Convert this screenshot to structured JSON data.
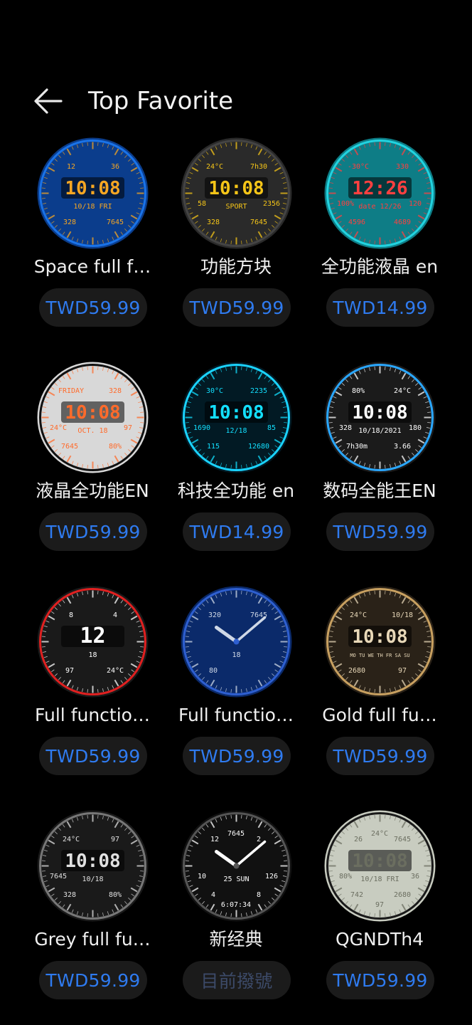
{
  "header": {
    "title": "Top Favorite",
    "back_icon": "back-arrow-icon"
  },
  "items": [
    {
      "name": "Space full f…",
      "price": "TWD59.99"
    },
    {
      "name": "功能方块",
      "price": "TWD59.99"
    },
    {
      "name": "全功能液晶 en",
      "price": "TWD14.99"
    },
    {
      "name": "液晶全功能EN",
      "price": "TWD59.99"
    },
    {
      "name": "科技全功能 en",
      "price": "TWD14.99"
    },
    {
      "name": "数码全能王EN",
      "price": "TWD59.99"
    },
    {
      "name": "Full functio…",
      "price": "TWD59.99"
    },
    {
      "name": "Full functio…",
      "price": "TWD59.99"
    },
    {
      "name": "Gold full fu…",
      "price": "TWD59.99"
    },
    {
      "name": "Grey full fu…",
      "price": "TWD59.99"
    },
    {
      "name": "新经典",
      "price": "目前撥號"
    },
    {
      "name": "QGNDTh4",
      "price": "TWD59.99"
    }
  ],
  "faces": [
    {
      "time": "10:08",
      "date": "10/18  FRI",
      "extra": [
        "12",
        "36",
        "328",
        "7645"
      ],
      "colors": [
        "#0b3d8c",
        "#1a73e8",
        "#f5a623"
      ]
    },
    {
      "time": "10:08",
      "date": "SPORT",
      "extra": [
        "24°C",
        "7h30",
        "328",
        "7645",
        "58",
        "2356"
      ],
      "colors": [
        "#2a2a2a",
        "#444",
        "#f5c518"
      ]
    },
    {
      "time": "12:26",
      "date": "date 12/26",
      "extra": [
        "-30°C",
        "330",
        "4596",
        "4689",
        "100%",
        "120"
      ],
      "colors": [
        "#0e7d86",
        "#22d3e0",
        "#ff4040"
      ]
    },
    {
      "time": "10:08",
      "date": "OCT. 18",
      "extra": [
        "FRIDAY",
        "328",
        "7645",
        "80%",
        "24°C",
        "97"
      ],
      "colors": [
        "#d8d8d8",
        "#111",
        "#ff6b2b"
      ]
    },
    {
      "time": "10:08",
      "date": "12/18",
      "extra": [
        "30°C",
        "2235",
        "115",
        "12680",
        "1690",
        "85"
      ],
      "colors": [
        "#021a24",
        "#1ad3ff",
        "#13e0ff"
      ]
    },
    {
      "time": "10:08",
      "date": "10/18/2021",
      "extra": [
        "80%",
        "24°C",
        "7h30m",
        "3.66",
        "328",
        "180"
      ],
      "colors": [
        "#1b1b1b",
        "#2aa7ff",
        "#ffffff"
      ]
    },
    {
      "time": "12",
      "date": "18",
      "extra": [
        "8",
        "4",
        "97",
        "24°C"
      ],
      "colors": [
        "#1a1a1a",
        "#e02020",
        "#ffffff"
      ]
    },
    {
      "time": "",
      "date": "18",
      "extra": [
        "320",
        "7645",
        "80"
      ],
      "colors": [
        "#0b2a6a",
        "#2e5fd0",
        "#cfd8e6"
      ]
    },
    {
      "time": "10:08",
      "date": "MO TU WE TH FR SA SU",
      "extra": [
        "24°C",
        "10/18",
        "2680",
        "97"
      ],
      "colors": [
        "#2a2218",
        "#c8a060",
        "#e8d8b8"
      ]
    },
    {
      "time": "10:08",
      "date": "10/18",
      "extra": [
        "24°C",
        "97",
        "328",
        "80%",
        "7645"
      ],
      "colors": [
        "#1a1a1a",
        "#777",
        "#e0e0e0"
      ]
    },
    {
      "time": "",
      "date": "25 SUN",
      "extra": [
        "12",
        "2",
        "4",
        "8",
        "10",
        "126",
        "7645",
        "6:07:34"
      ],
      "colors": [
        "#111",
        "#555",
        "#ffffff"
      ]
    },
    {
      "time": "10:08",
      "date": "10/18  FRI",
      "extra": [
        "26",
        "7645",
        "742",
        "2680",
        "80%",
        "36",
        "24°C",
        "97"
      ],
      "colors": [
        "#c8ccc0",
        "#1a1a1a",
        "#6b6e60"
      ]
    }
  ]
}
